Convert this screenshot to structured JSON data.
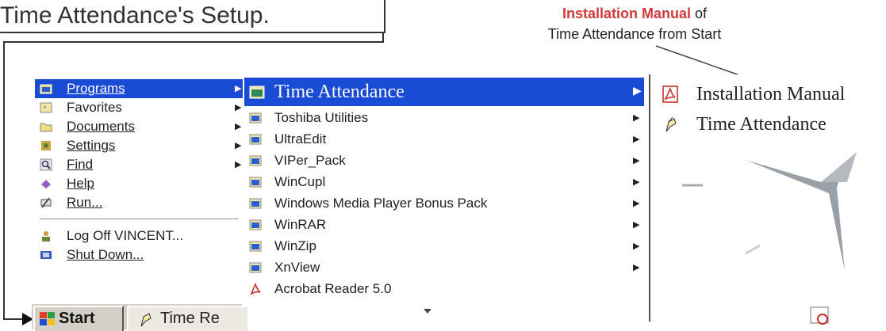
{
  "callout": {
    "text": "Time Attendance's Setup."
  },
  "annotation": {
    "highlight": "Installation Manual",
    "of_text": " of",
    "line2": "Time Attendance from Start"
  },
  "start_menu": {
    "items": [
      {
        "label": "Programs",
        "icon": "programs-icon",
        "has_submenu": true,
        "selected": true
      },
      {
        "label": "Favorites",
        "icon": "favorites-icon",
        "has_submenu": true
      },
      {
        "label": "Documents",
        "icon": "documents-icon",
        "has_submenu": true
      },
      {
        "label": "Settings",
        "icon": "settings-icon",
        "has_submenu": true
      },
      {
        "label": "Find",
        "icon": "find-icon",
        "has_submenu": true
      },
      {
        "label": "Help",
        "icon": "help-icon"
      },
      {
        "label": "Run...",
        "icon": "run-icon"
      },
      {
        "label": "Log Off VINCENT...",
        "icon": "logoff-icon"
      },
      {
        "label": "Shut Down...",
        "icon": "shutdown-icon"
      }
    ]
  },
  "programs_menu": {
    "items": [
      {
        "label": "Time Attendance",
        "icon": "program-group-icon",
        "has_submenu": true,
        "selected": true
      },
      {
        "label": "Toshiba Utilities",
        "icon": "program-group-icon",
        "has_submenu": true
      },
      {
        "label": "UltraEdit",
        "icon": "program-group-icon",
        "has_submenu": true
      },
      {
        "label": "VIPer_Pack",
        "icon": "program-group-icon",
        "has_submenu": true
      },
      {
        "label": "WinCupl",
        "icon": "program-group-icon",
        "has_submenu": true
      },
      {
        "label": "Windows Media Player Bonus Pack",
        "icon": "program-group-icon",
        "has_submenu": true
      },
      {
        "label": "WinRAR",
        "icon": "program-group-icon",
        "has_submenu": true
      },
      {
        "label": "WinZip",
        "icon": "program-group-icon",
        "has_submenu": true
      },
      {
        "label": "XnView",
        "icon": "program-group-icon",
        "has_submenu": true
      },
      {
        "label": "Acrobat Reader 5.0",
        "icon": "acrobat-icon"
      }
    ]
  },
  "time_attendance_menu": {
    "items": [
      {
        "label": "Installation Manual",
        "icon": "pdf-icon"
      },
      {
        "label": "Time Attendance",
        "icon": "time-attendance-icon"
      }
    ]
  },
  "taskbar": {
    "start_label": "Start",
    "task_label": "Time Re"
  },
  "colors": {
    "selection": "#1a4bd4",
    "annotation_red": "#d03a3a"
  }
}
